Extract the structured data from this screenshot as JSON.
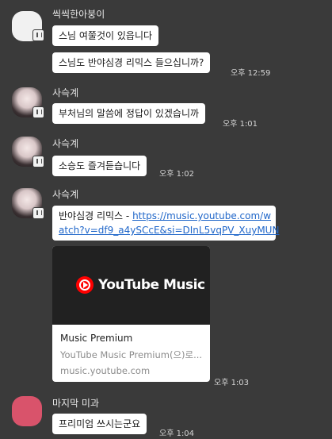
{
  "messages": [
    {
      "sender": "씩씩한아붕이",
      "bubbles": [
        "스님 여쭐것이 있읍니다",
        "스님도  반야심경 리믹스 들으십니까?"
      ],
      "time": "오후 12:59"
    },
    {
      "sender": "사슥계",
      "bubbles": [
        "부처님의 말씀에 정답이 있겠습니까"
      ],
      "time": "오후 1:01"
    },
    {
      "sender": "사슥계",
      "bubbles": [
        "소승도 즐겨듣습니다"
      ],
      "time": "오후 1:02"
    },
    {
      "sender": "사슥계",
      "link_message": {
        "prefix": "반야심경 리믹스 - ",
        "url_line1": "https://music.youtube.com/w",
        "url_line2": "atch?v=df9_a4ySCcE&si=DInL5vqPV_XuyMUN"
      },
      "preview": {
        "brand": "YouTube Music",
        "title": "Music Premium",
        "description": "YouTube Music Premium(으)로...",
        "domain": "music.youtube.com"
      },
      "time": "오후 1:03"
    },
    {
      "sender": "마지막 미과",
      "bubbles": [
        "프리미엄 쓰시는군요"
      ],
      "time": "오후 1:04"
    }
  ],
  "colors": {
    "background": "#3a3a3a",
    "bubble": "#ffffff",
    "link": "#1f66c9",
    "youtube_red": "#ff0000"
  }
}
